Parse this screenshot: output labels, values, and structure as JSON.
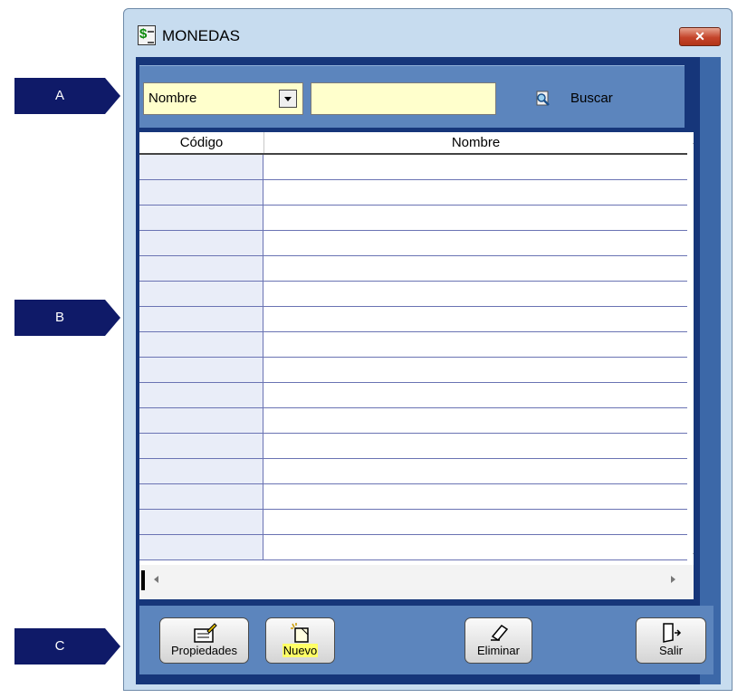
{
  "callouts": {
    "a": "A",
    "b": "B",
    "c": "C"
  },
  "window": {
    "title": "MONEDAS",
    "close_symbol": "✕"
  },
  "filter": {
    "field_selected": "Nombre",
    "search_value": "",
    "buscar_label": "Buscar"
  },
  "grid": {
    "columns": [
      "Código",
      "Nombre"
    ],
    "row_count": 16,
    "rows": []
  },
  "toolbar": {
    "propiedades_label": "Propiedades",
    "nuevo_label": "Nuevo",
    "eliminar_label": "Eliminar",
    "salir_label": "Salir"
  },
  "colors": {
    "callout": "#0f1a68",
    "frame": "#16367a",
    "panel": "#5c85bd",
    "input_bg": "#ffffcc",
    "close_button": "#c4442a"
  },
  "icons": {
    "window": "dollar-document-icon",
    "dropdown": "chevron-down-icon",
    "search": "search-icon",
    "properties": "properties-icon",
    "new": "new-document-icon",
    "delete": "eraser-icon",
    "exit": "exit-door-icon"
  }
}
